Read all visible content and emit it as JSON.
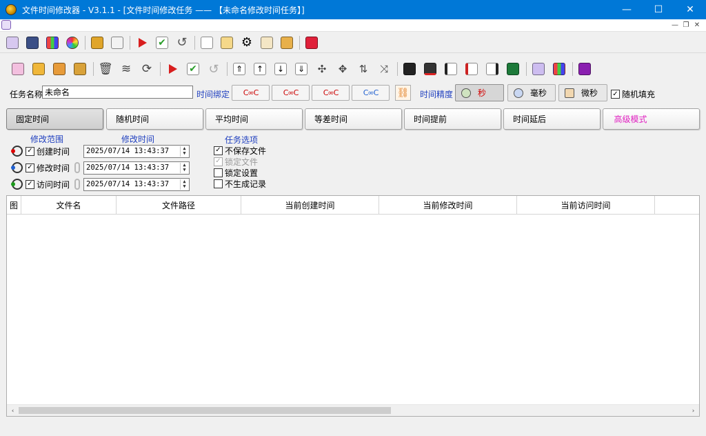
{
  "window": {
    "title": "文件时间修改器 - V3.1.1 - [文件时间修改任务 —— 【未命名修改时间任务】]",
    "controls": [
      "minimize",
      "maximize",
      "close"
    ],
    "accent": "#0078d7"
  },
  "toolbar1": {
    "icons": [
      "schedule-icon",
      "save-schedule-icon",
      "palette-icon",
      "color-wheel-icon",
      "open-folder-icon",
      "paste-icon",
      "run-icon",
      "check-icon",
      "undo-icon",
      "preview-icon",
      "notepad-icon",
      "settings-icon",
      "document-icon",
      "about-icon",
      "exit-icon"
    ]
  },
  "toolbar2": {
    "icons": [
      "add-files-icon",
      "add-folder-icon",
      "import-icon",
      "import-list-icon",
      "delete-icon",
      "clear-icon",
      "refresh-icon",
      "run-icon",
      "check-icon",
      "undo-icon",
      "move-top-icon",
      "move-up-icon",
      "move-down-icon",
      "move-bottom-icon",
      "collapse-icon",
      "expand-icon",
      "sort-icon",
      "shuffle-icon",
      "save-icon",
      "save-as-icon",
      "export-text-icon",
      "export-excel-icon",
      "export-list-icon",
      "export-csv-icon",
      "schedule-icon",
      "palette-icon",
      "help-book-icon"
    ]
  },
  "task": {
    "name_label": "任务名称",
    "name_value": "未命名",
    "bind_label": "时间绑定",
    "precision_label": "时间精度",
    "precision_options": [
      "秒",
      "毫秒",
      "微秒"
    ],
    "precision_selected": "秒",
    "random_fill_label": "随机填充",
    "random_fill_checked": true
  },
  "mode_tabs": {
    "items": [
      "固定时间",
      "随机时间",
      "平均时间",
      "等差时间",
      "时间提前",
      "时间延后",
      "高级模式"
    ],
    "active": "固定时间",
    "advanced_color": "#e020c0"
  },
  "settings": {
    "scope_header": "修改范围",
    "time_header": "修改时间",
    "rows": [
      {
        "label": "创建时间",
        "checked": true,
        "value": "2025/07/14 13:43:37"
      },
      {
        "label": "修改时间",
        "checked": true,
        "value": "2025/07/14 13:43:37"
      },
      {
        "label": "访问时间",
        "checked": true,
        "value": "2025/07/14 13:43:37"
      }
    ],
    "options_header": "任务选项",
    "options": [
      {
        "label": "不保存文件",
        "checked": true,
        "disabled": false
      },
      {
        "label": "锁定文件",
        "checked": true,
        "disabled": true
      },
      {
        "label": "锁定设置",
        "checked": false,
        "disabled": false
      },
      {
        "label": "不生成记录",
        "checked": false,
        "disabled": false
      }
    ]
  },
  "table": {
    "columns": [
      "图",
      "文件名",
      "文件路径",
      "当前创建时间",
      "当前修改时间",
      "当前访问时间"
    ],
    "rows": []
  },
  "scrollbar": {
    "left_arrow": "‹",
    "right_arrow": "›"
  }
}
